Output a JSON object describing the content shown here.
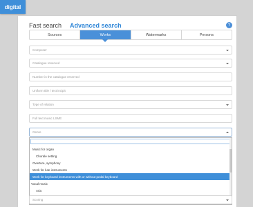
{
  "logo": {
    "text": "digital"
  },
  "header": {
    "fast_search": "Fast search",
    "advanced_search": "Advanced search",
    "help": "?"
  },
  "tabs": [
    {
      "label": "Sources"
    },
    {
      "label": "Works"
    },
    {
      "label": "Watermarks"
    },
    {
      "label": "Persons"
    }
  ],
  "form": {
    "composer": "Composer",
    "catalogue": "Catalogue reserved",
    "catalogue_number": "Number in the catalogue reserved",
    "uniform_title": "Uniform title / text incipit",
    "type_of_relation": "Type of relation",
    "full_text": "Full text music LSME",
    "genre": "Genre",
    "scoring": "Scoring"
  },
  "genre_options": [
    {
      "label": "Music for organ"
    },
    {
      "label": "Chorale setting"
    },
    {
      "label": "Overture, symphony"
    },
    {
      "label": "Work for lute instruments"
    },
    {
      "label": "Work for keyboard instruments with or without pedal keyboard"
    },
    {
      "label": "Vocal music"
    },
    {
      "label": "Aria"
    }
  ]
}
